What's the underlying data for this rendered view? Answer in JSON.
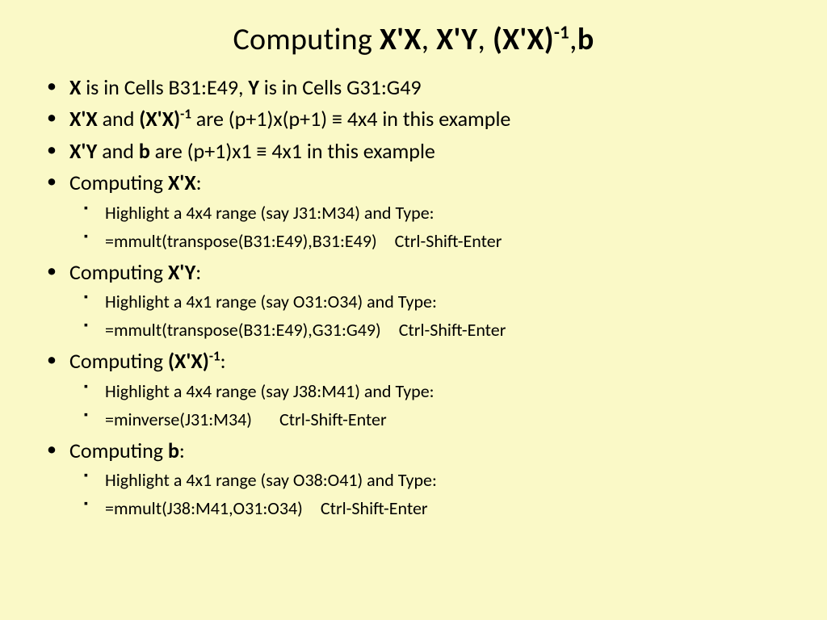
{
  "title": {
    "pre": "Computing ",
    "t1": "X'X",
    "c1": ", ",
    "t2": "X'Y",
    "c2": ", ",
    "t3a": "(X'X)",
    "t3sup": "-1",
    "c3": ",",
    "t4": "b"
  },
  "b1": {
    "x": "X",
    "a": " is in Cells B31:E49, ",
    "y": "Y",
    "b": " is in Cells G31:G49"
  },
  "b2": {
    "t1": "X'X",
    "a": " and ",
    "t2a": "(X'X)",
    "t2sup": "-1",
    "b": " are (p+1)x(p+1) ≡ 4x4 in this example"
  },
  "b3": {
    "t1": "X'Y",
    "a": " and ",
    "t2": "b",
    "b": " are (p+1)x1 ≡ 4x1 in this example"
  },
  "b4": {
    "a": "Computing ",
    "t": "X'X",
    "c": ":",
    "s1": "Highlight a 4x4 range (say J31:M34) and Type:",
    "s2a": "=mmult(transpose(B31:E49),B31:E49)",
    "s2b": "Ctrl-Shift-Enter"
  },
  "b5": {
    "a": "Computing ",
    "t": "X'Y",
    "c": ":",
    "s1": "Highlight a 4x1 range (say O31:O34) and Type:",
    "s2a": "=mmult(transpose(B31:E49),G31:G49)",
    "s2b": "Ctrl-Shift-Enter"
  },
  "b6": {
    "a": "Computing ",
    "ta": "(X'X)",
    "tsup": "-1",
    "c": ":",
    "s1": "Highlight a 4x4 range (say J38:M41) and Type:",
    "s2a": "=minverse(J31:M34)",
    "s2b": "Ctrl-Shift-Enter"
  },
  "b7": {
    "a": "Computing ",
    "t": "b",
    "c": ":",
    "s1": "Highlight a 4x1 range (say O38:O41) and Type:",
    "s2a": "=mmult(J38:M41,O31:O34)",
    "s2b": "Ctrl-Shift-Enter"
  }
}
